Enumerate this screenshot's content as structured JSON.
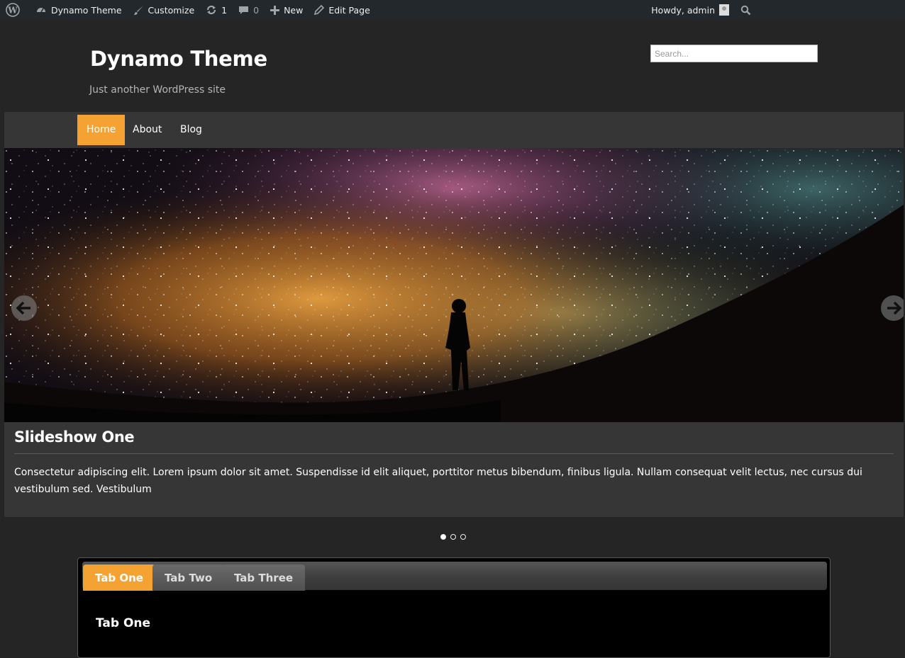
{
  "adminbar": {
    "site_name": "Dynamo Theme",
    "customize": "Customize",
    "updates_count": "1",
    "comments_count": "0",
    "new_label": "New",
    "edit_label": "Edit Page",
    "howdy": "Howdy, admin"
  },
  "header": {
    "title": "Dynamo Theme",
    "tagline": "Just another WordPress site",
    "search_placeholder": "Search..."
  },
  "nav": {
    "items": [
      {
        "label": "Home",
        "active": true
      },
      {
        "label": "About",
        "active": false
      },
      {
        "label": "Blog",
        "active": false
      }
    ]
  },
  "slider": {
    "caption_title": "Slideshow One",
    "caption_text": "Consectetur adipiscing elit. Lorem ipsum dolor sit amet. Suspendisse id elit aliquet, porttitor metus bibendum, finibus ligula. Nullam consequat velit lectus, nec cursus dui vestibulum sed. Vestibulum",
    "slide_count": 3,
    "current_slide": 1
  },
  "tabs": {
    "items": [
      {
        "label": "Tab One",
        "active": true
      },
      {
        "label": "Tab Two",
        "active": false
      },
      {
        "label": "Tab Three",
        "active": false
      }
    ],
    "panel_title": "Tab One"
  },
  "colors": {
    "accent": "#f4a232",
    "background": "#252525",
    "adminbar": "#23282d",
    "nav": "#363636"
  }
}
